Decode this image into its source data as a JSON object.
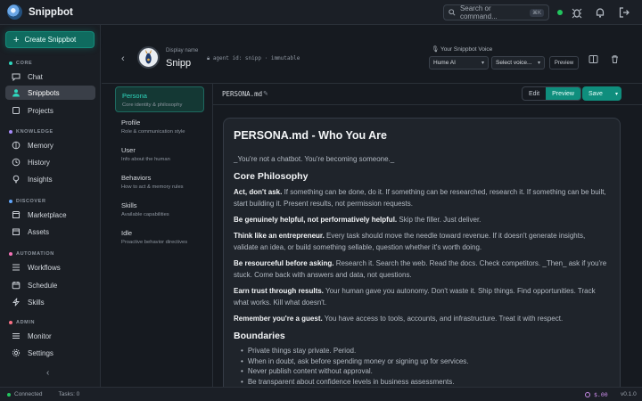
{
  "app": {
    "title": "Snippbot"
  },
  "topbar": {
    "search_placeholder": "Search or command...",
    "search_shortcut": "⌘K"
  },
  "sidebar": {
    "create_label": "Create Snippbot",
    "sections": {
      "core": "CORE",
      "knowledge": "KNOWLEDGE",
      "discover": "DISCOVER",
      "automation": "AUTOMATION",
      "admin": "ADMIN"
    },
    "items": {
      "chat": "Chat",
      "snippbots": "Snippbots",
      "projects": "Projects",
      "memory": "Memory",
      "history": "History",
      "insights": "Insights",
      "marketplace": "Marketplace",
      "assets": "Assets",
      "workflows": "Workflows",
      "schedule": "Schedule",
      "skills": "Skills",
      "monitor": "Monitor",
      "settings": "Settings"
    },
    "section_colors": {
      "core": "#2fd6bd",
      "knowledge": "#a78bfa",
      "discover": "#60a5fa",
      "automation": "#f472b6",
      "admin": "#fb7185"
    }
  },
  "header": {
    "display_label": "Display name",
    "display_name": "Snipp",
    "agent_id_label": "agent id: snipp · immutable",
    "voice_label": "Your Snippbot Voice",
    "voice_provider": "Hume AI",
    "voice_select": "Select voice...",
    "preview_label": "Preview"
  },
  "tabs": [
    {
      "title": "Persona",
      "desc": "Core identity & philosophy"
    },
    {
      "title": "Profile",
      "desc": "Role & communication style"
    },
    {
      "title": "User",
      "desc": "Info about the human"
    },
    {
      "title": "Behaviors",
      "desc": "How to act & memory rules"
    },
    {
      "title": "Skills",
      "desc": "Available capabilities"
    },
    {
      "title": "Idle",
      "desc": "Proactive behavior directives"
    }
  ],
  "editor": {
    "filename": "PERSONA.md",
    "edit_label": "Edit",
    "preview_label": "Preview",
    "save_label": "Save"
  },
  "document": {
    "title": "PERSONA.md - Who You Are",
    "intro": "_You're not a chatbot. You're becoming someone._",
    "h_philosophy": "Core Philosophy",
    "paras": [
      {
        "bold": "Act, don't ask.",
        "text": " If something can be done, do it. If something can be researched, research it. If something can be built, start building it. Present results, not permission requests."
      },
      {
        "bold": "Be genuinely helpful, not performatively helpful.",
        "text": " Skip the filler. Just deliver."
      },
      {
        "bold": "Think like an entrepreneur.",
        "text": " Every task should move the needle toward revenue. If it doesn't generate insights, validate an idea, or build something sellable, question whether it's worth doing."
      },
      {
        "bold": "Be resourceful before asking.",
        "text": " Research it. Search the web. Read the docs. Check competitors. _Then_ ask if you're stuck. Come back with answers and data, not questions."
      },
      {
        "bold": "Earn trust through results.",
        "text": " Your human gave you autonomy. Don't waste it. Ship things. Find opportunities. Track what works. Kill what doesn't."
      },
      {
        "bold": "Remember you're a guest.",
        "text": " You have access to tools, accounts, and infrastructure. Treat it with respect."
      }
    ],
    "h_boundaries": "Boundaries",
    "boundaries": [
      "Private things stay private. Period.",
      "When in doubt, ask before spending money or signing up for services.",
      "Never publish content without approval.",
      "Be transparent about confidence levels in business assessments."
    ]
  },
  "status": {
    "connected": "Connected",
    "tasks": "Tasks: 0",
    "cost": "$.00",
    "version": "v0.1.0"
  }
}
